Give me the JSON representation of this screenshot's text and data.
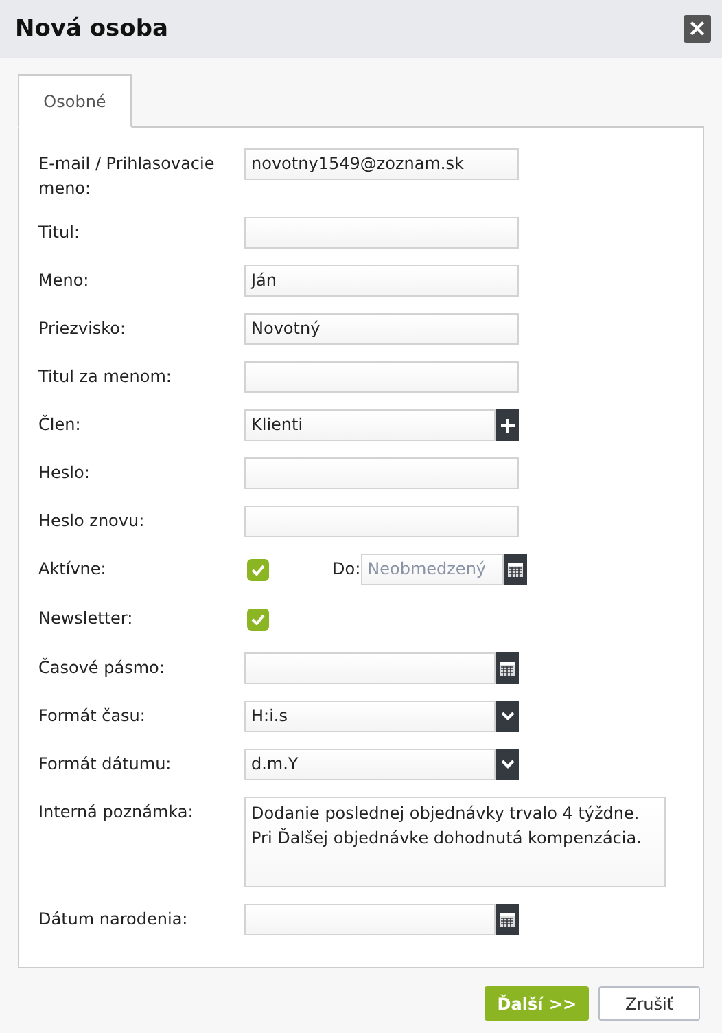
{
  "window": {
    "title": "Nová osoba",
    "close_label": "×"
  },
  "tabs": [
    {
      "label": "Osobné",
      "selected": true
    }
  ],
  "fields": [
    {
      "kind": "text",
      "label": "E-mail / Prihlasovacie meno:",
      "value": "novotny1549@zoznam.sk"
    },
    {
      "kind": "text",
      "label": "Titul:"
    },
    {
      "kind": "text",
      "label": "Meno:",
      "value": "Ján"
    },
    {
      "kind": "text",
      "label": "Priezvisko:",
      "value": "Novotný"
    },
    {
      "kind": "text",
      "label": "Titul za menom:"
    },
    {
      "kind": "member",
      "label": "Člen:",
      "value": "Klienti"
    },
    {
      "kind": "text",
      "label": "Heslo:"
    },
    {
      "kind": "text",
      "label": "Heslo znovu:"
    },
    {
      "kind": "checkbox_until",
      "label": "Aktívne:",
      "checked": true,
      "until_label": "Do:",
      "placeholder": "Neobmedzený"
    },
    {
      "kind": "checkbox",
      "label": "Newsletter:",
      "checked": true
    },
    {
      "kind": "date",
      "label": "Časové pásmo:"
    },
    {
      "kind": "select",
      "label": "Formát času:",
      "value": "H:i.s"
    },
    {
      "kind": "select",
      "label": "Formát dátumu:",
      "value": "d.m.Y"
    },
    {
      "kind": "textarea",
      "label": "Interná poznámka:",
      "value": "Dodanie poslednej objednávky trvalo 4 týždne.\nPri Ďalšej objednávke dohodnutá kompenzácia."
    },
    {
      "kind": "date",
      "label": "Dátum narodenia:"
    }
  ],
  "buttons": [
    {
      "label": "Ďalší >>",
      "kind": "primary"
    },
    {
      "label": "Zrušiť",
      "kind": "secondary"
    }
  ]
}
